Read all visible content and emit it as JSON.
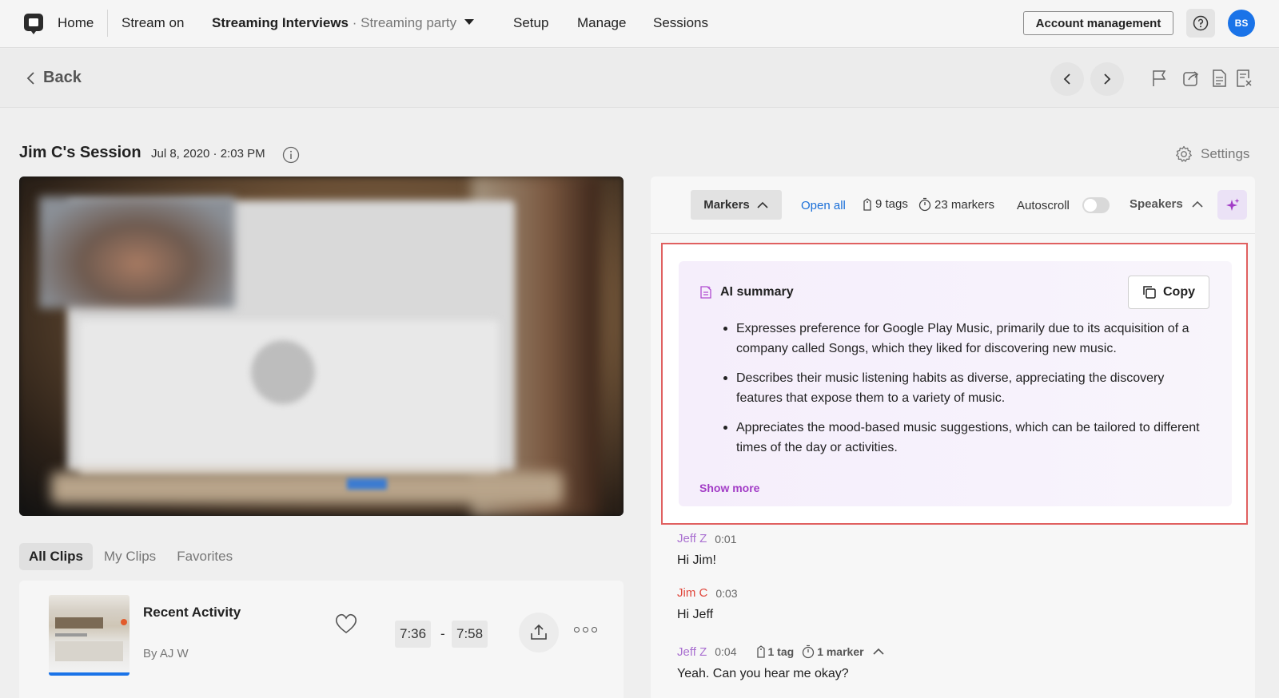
{
  "topnav": {
    "home": "Home",
    "stream": "Stream on",
    "project_name": "Streaming Interviews",
    "project_sep": " · ",
    "project_sub": "Streaming party",
    "links": [
      "Setup",
      "Manage",
      "Sessions"
    ],
    "account_button": "Account management",
    "avatar_initials": "BS"
  },
  "subbar": {
    "back_label": "Back"
  },
  "session": {
    "title": "Jim C's Session",
    "date": "Jul 8, 2020 · 2:03 PM",
    "settings_label": "Settings"
  },
  "clips": {
    "tabs": [
      "All Clips",
      "My Clips",
      "Favorites"
    ],
    "active_tab": "All Clips",
    "card": {
      "title": "Recent Activity",
      "author": "By AJ W",
      "start": "7:36",
      "dash": "-",
      "end": "7:58"
    }
  },
  "panel": {
    "markers_label": "Markers",
    "open_all": "Open all",
    "tags": "9 tags",
    "markers": "23 markers",
    "autoscroll": "Autoscroll",
    "autoscroll_on": false,
    "speakers": "Speakers",
    "summary": {
      "title": "AI summary",
      "copy_label": "Copy",
      "bullets": [
        "Expresses preference for Google Play Music, primarily due to its acquisition of a company called Songs, which they liked for discovering new music.",
        "Describes their music listening habits as diverse, appreciating the discovery features that expose them to a variety of music.",
        "Appreciates the mood-based music suggestions, which can be tailored to different times of the day or activities."
      ],
      "show_more": "Show more"
    },
    "transcript": [
      {
        "speaker": "Jeff Z",
        "time": "0:01",
        "text": "Hi Jim!"
      },
      {
        "speaker": "Jim C",
        "time": "0:03",
        "text": "Hi Jeff"
      },
      {
        "speaker": "Jeff Z",
        "time": "0:04",
        "tags": "1 tag",
        "markers": "1 marker",
        "text": "Yeah. Can you hear me okay?"
      }
    ]
  },
  "colors": {
    "accent_blue": "#1a73e8",
    "link_blue": "#1a6fd8",
    "ai_purple": "#a23cc6",
    "speaker_jeff": "#a96fd0",
    "speaker_jim": "#e0453a",
    "highlight_border": "#e06060"
  },
  "icons": [
    "app-logo-icon",
    "caret-down-icon",
    "help-icon",
    "chevron-left-icon",
    "chevron-right-icon",
    "flag-icon",
    "share-icon",
    "document-icon",
    "document-close-icon",
    "info-icon",
    "gear-icon",
    "heart-icon",
    "upload-icon",
    "more-icon",
    "tag-icon",
    "timer-icon",
    "chevron-up-icon",
    "sparkle-icon",
    "ai-summary-icon",
    "copy-icon"
  ]
}
